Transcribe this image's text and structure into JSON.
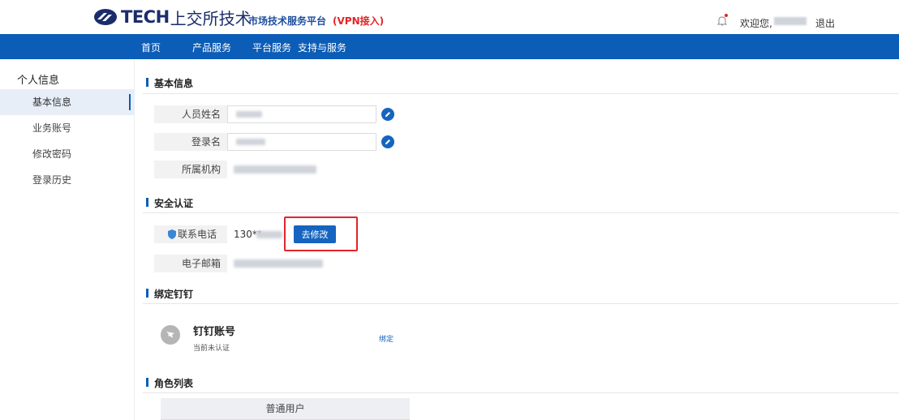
{
  "header": {
    "logo_text": "TECH",
    "logo_cn": "上交所技术",
    "platform_name": "市场技术服务平台",
    "vpn_label": "(VPN接入)",
    "welcome": "欢迎您,",
    "logout": "退出"
  },
  "nav": {
    "items": [
      "首页",
      "产品服务",
      "平台服务",
      "支持与服务"
    ]
  },
  "sidebar": {
    "title": "个人信息",
    "items": [
      "基本信息",
      "业务账号",
      "修改密码",
      "登录历史"
    ],
    "active_index": 0
  },
  "sections": {
    "basic": {
      "title": "基本信息",
      "fields": [
        {
          "label": "人员姓名"
        },
        {
          "label": "登录名"
        },
        {
          "label": "所属机构"
        }
      ]
    },
    "security": {
      "title": "安全认证",
      "phone_label": "联系电话",
      "phone_value": "130**",
      "edit_button": "去修改",
      "email_label": "电子邮箱"
    },
    "dingtalk": {
      "title": "绑定钉钉",
      "account_label": "钉钉账号",
      "status": "当前未认证",
      "bind_link": "绑定"
    },
    "roles": {
      "title": "角色列表",
      "items": [
        "普通用户"
      ]
    }
  },
  "colors": {
    "primary": "#0b5db7",
    "accent_red": "#e0252a"
  }
}
